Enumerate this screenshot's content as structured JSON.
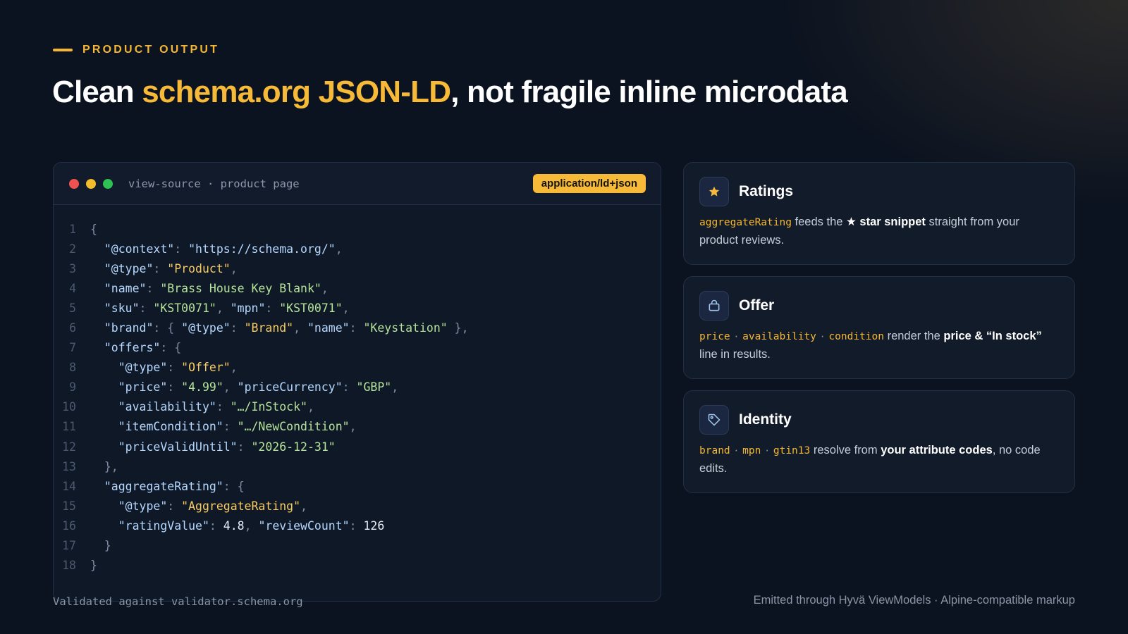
{
  "eyebrow": "PRODUCT OUTPUT",
  "headline": {
    "pre": "Clean ",
    "accent": "schema.org JSON-LD",
    "post": ", not fragile inline microdata"
  },
  "code_window": {
    "title": "view-source · product page",
    "badge": "application/ld+json",
    "lines": [
      {
        "num": "1",
        "tokens": [
          {
            "t": "{",
            "c": "p"
          }
        ]
      },
      {
        "num": "2",
        "tokens": [
          {
            "t": "  \"@context\"",
            "c": "k"
          },
          {
            "t": ": ",
            "c": "p"
          },
          {
            "t": "\"https://schema.org/\"",
            "c": "k"
          },
          {
            "t": ",",
            "c": "p"
          }
        ]
      },
      {
        "num": "3",
        "tokens": [
          {
            "t": "  \"@type\"",
            "c": "k"
          },
          {
            "t": ": ",
            "c": "p"
          },
          {
            "t": "\"Product\"",
            "c": "y"
          },
          {
            "t": ",",
            "c": "p"
          }
        ]
      },
      {
        "num": "4",
        "tokens": [
          {
            "t": "  \"name\"",
            "c": "k"
          },
          {
            "t": ": ",
            "c": "p"
          },
          {
            "t": "\"Brass House Key Blank\"",
            "c": "s"
          },
          {
            "t": ",",
            "c": "p"
          }
        ]
      },
      {
        "num": "5",
        "tokens": [
          {
            "t": "  \"sku\"",
            "c": "k"
          },
          {
            "t": ": ",
            "c": "p"
          },
          {
            "t": "\"KST0071\"",
            "c": "s"
          },
          {
            "t": ", ",
            "c": "p"
          },
          {
            "t": "\"mpn\"",
            "c": "k"
          },
          {
            "t": ": ",
            "c": "p"
          },
          {
            "t": "\"KST0071\"",
            "c": "s"
          },
          {
            "t": ",",
            "c": "p"
          }
        ]
      },
      {
        "num": "6",
        "tokens": [
          {
            "t": "  \"brand\"",
            "c": "k"
          },
          {
            "t": ": { ",
            "c": "p"
          },
          {
            "t": "\"@type\"",
            "c": "k"
          },
          {
            "t": ": ",
            "c": "p"
          },
          {
            "t": "\"Brand\"",
            "c": "y"
          },
          {
            "t": ", ",
            "c": "p"
          },
          {
            "t": "\"name\"",
            "c": "k"
          },
          {
            "t": ": ",
            "c": "p"
          },
          {
            "t": "\"Keystation\"",
            "c": "s"
          },
          {
            "t": " },",
            "c": "p"
          }
        ]
      },
      {
        "num": "7",
        "tokens": [
          {
            "t": "  \"offers\"",
            "c": "k"
          },
          {
            "t": ": {",
            "c": "p"
          }
        ]
      },
      {
        "num": "8",
        "tokens": [
          {
            "t": "    \"@type\"",
            "c": "k"
          },
          {
            "t": ": ",
            "c": "p"
          },
          {
            "t": "\"Offer\"",
            "c": "y"
          },
          {
            "t": ",",
            "c": "p"
          }
        ]
      },
      {
        "num": "9",
        "tokens": [
          {
            "t": "    \"price\"",
            "c": "k"
          },
          {
            "t": ": ",
            "c": "p"
          },
          {
            "t": "\"4.99\"",
            "c": "s"
          },
          {
            "t": ", ",
            "c": "p"
          },
          {
            "t": "\"priceCurrency\"",
            "c": "k"
          },
          {
            "t": ": ",
            "c": "p"
          },
          {
            "t": "\"GBP\"",
            "c": "s"
          },
          {
            "t": ",",
            "c": "p"
          }
        ]
      },
      {
        "num": "10",
        "tokens": [
          {
            "t": "    \"availability\"",
            "c": "k"
          },
          {
            "t": ": ",
            "c": "p"
          },
          {
            "t": "\"…/InStock\"",
            "c": "s"
          },
          {
            "t": ",",
            "c": "p"
          }
        ]
      },
      {
        "num": "11",
        "tokens": [
          {
            "t": "    \"itemCondition\"",
            "c": "k"
          },
          {
            "t": ": ",
            "c": "p"
          },
          {
            "t": "\"…/NewCondition\"",
            "c": "s"
          },
          {
            "t": ",",
            "c": "p"
          }
        ]
      },
      {
        "num": "12",
        "tokens": [
          {
            "t": "    \"priceValidUntil\"",
            "c": "k"
          },
          {
            "t": ": ",
            "c": "p"
          },
          {
            "t": "\"2026-12-31\"",
            "c": "s"
          }
        ]
      },
      {
        "num": "13",
        "tokens": [
          {
            "t": "  },",
            "c": "p"
          }
        ]
      },
      {
        "num": "14",
        "tokens": [
          {
            "t": "  \"aggregateRating\"",
            "c": "k"
          },
          {
            "t": ": {",
            "c": "p"
          }
        ]
      },
      {
        "num": "15",
        "tokens": [
          {
            "t": "    \"@type\"",
            "c": "k"
          },
          {
            "t": ": ",
            "c": "p"
          },
          {
            "t": "\"AggregateRating\"",
            "c": "y"
          },
          {
            "t": ",",
            "c": "p"
          }
        ]
      },
      {
        "num": "16",
        "tokens": [
          {
            "t": "    \"ratingValue\"",
            "c": "k"
          },
          {
            "t": ": ",
            "c": "p"
          },
          {
            "t": "4.8",
            "c": "n"
          },
          {
            "t": ", ",
            "c": "p"
          },
          {
            "t": "\"reviewCount\"",
            "c": "k"
          },
          {
            "t": ": ",
            "c": "p"
          },
          {
            "t": "126",
            "c": "n"
          }
        ]
      },
      {
        "num": "17",
        "tokens": [
          {
            "t": "  }",
            "c": "p"
          }
        ]
      },
      {
        "num": "18",
        "tokens": [
          {
            "t": "}",
            "c": "p"
          }
        ]
      }
    ]
  },
  "footer": {
    "left": "Validated against validator.schema.org",
    "right": "Emitted through Hyvä ViewModels · Alpine-compatible markup"
  },
  "cards": {
    "ratings": {
      "icon": "star-icon",
      "title": "Ratings",
      "token": "aggregateRating",
      "text1": " feeds the ",
      "strong": "★ star snippet",
      "text2": " straight from your product reviews."
    },
    "offer": {
      "icon": "bag-icon",
      "title": "Offer",
      "tokens": [
        "price",
        "availability",
        "condition"
      ],
      "text1": " render the ",
      "strong": "price & “In stock”",
      "text2": " line in results."
    },
    "identity": {
      "icon": "tag-icon",
      "title": "Identity",
      "tokens": [
        "brand",
        "mpn",
        "gtin13"
      ],
      "text1": " resolve from ",
      "strong": "your attribute codes",
      "text2": ", no code edits."
    }
  },
  "colors": {
    "accent": "#f6b938",
    "background": "#0c1320",
    "card": "#121b2a"
  }
}
